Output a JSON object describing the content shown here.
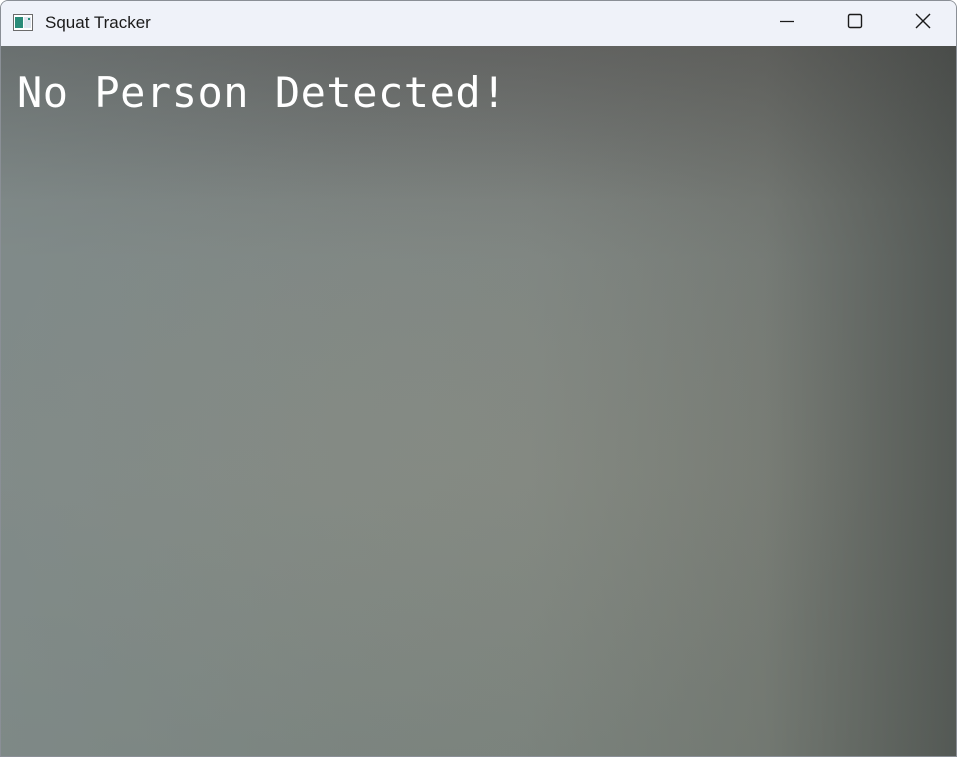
{
  "window": {
    "title": "Squat Tracker",
    "app_icon": "opencv-window-icon",
    "controls": {
      "minimize_icon": "minimize-icon",
      "maximize_icon": "maximize-icon",
      "close_icon": "close-icon"
    }
  },
  "video": {
    "status_text": "No Person Detected!",
    "status_color": "#ffffff"
  }
}
